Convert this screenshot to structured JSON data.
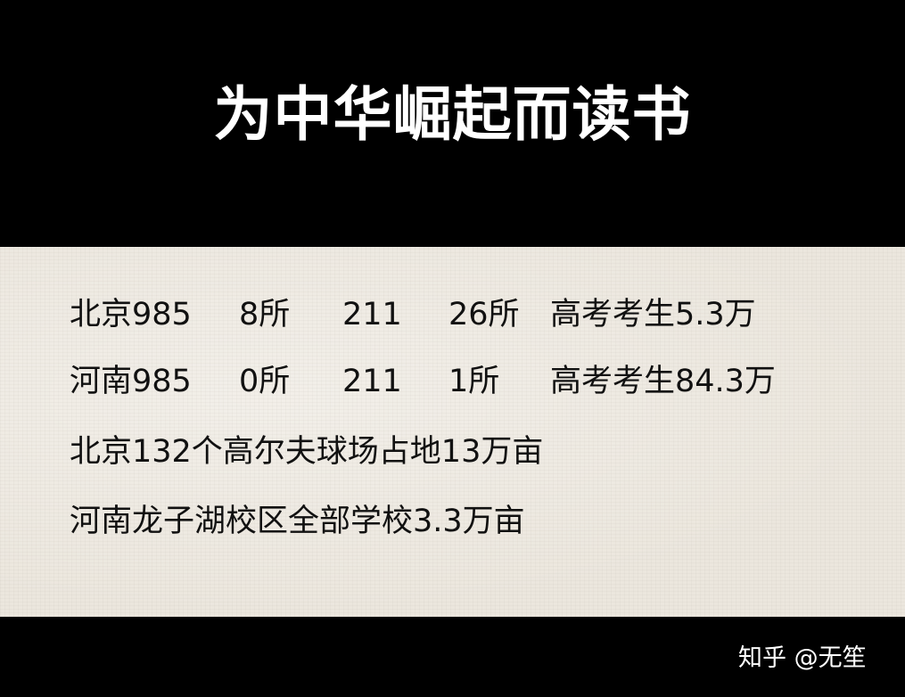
{
  "headline": "为中华崛起而读书",
  "rows": [
    {
      "a": "北京985",
      "b": "8所",
      "c": "211",
      "d": "26所",
      "e": "高考考生5.3万"
    },
    {
      "a": "河南985",
      "b": "0所",
      "c": "211",
      "d": "1所",
      "e": "高考考生84.3万"
    }
  ],
  "facts": [
    "北京132个高尔夫球场占地13万亩",
    "河南龙子湖校区全部学校3.3万亩"
  ],
  "watermark": "知乎 @无笙",
  "colors": {
    "band": "#000000",
    "paper": "#ebe6dd",
    "text": "#111111",
    "headline": "#ffffff"
  }
}
